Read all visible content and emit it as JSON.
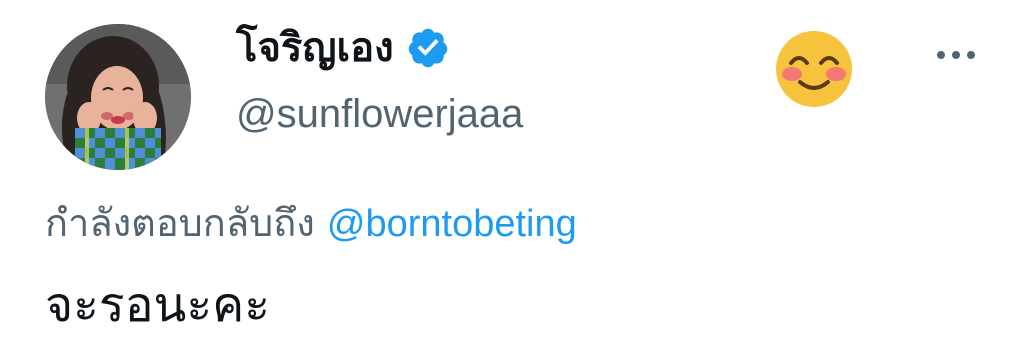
{
  "author": {
    "display_name": "โจริญเอง",
    "handle": "@sunflowerjaaa",
    "verified": true,
    "avatar_icon": "profile-photo",
    "status_emoji": "smiling-face-with-smiling-eyes"
  },
  "reply": {
    "prefix": "กำลังตอบกลับถึง",
    "handle": "@borntobeting"
  },
  "tweet": {
    "text": "จะรอนะคะ"
  },
  "colors": {
    "link": "#1d9bf0",
    "secondary_text": "#536471",
    "primary_text": "#0f1419",
    "verified_badge": "#1d9bf0",
    "emoji_face": "#f7c23c"
  },
  "icons": {
    "more": "more-horizontal-icon",
    "verified": "verified-badge-icon"
  }
}
